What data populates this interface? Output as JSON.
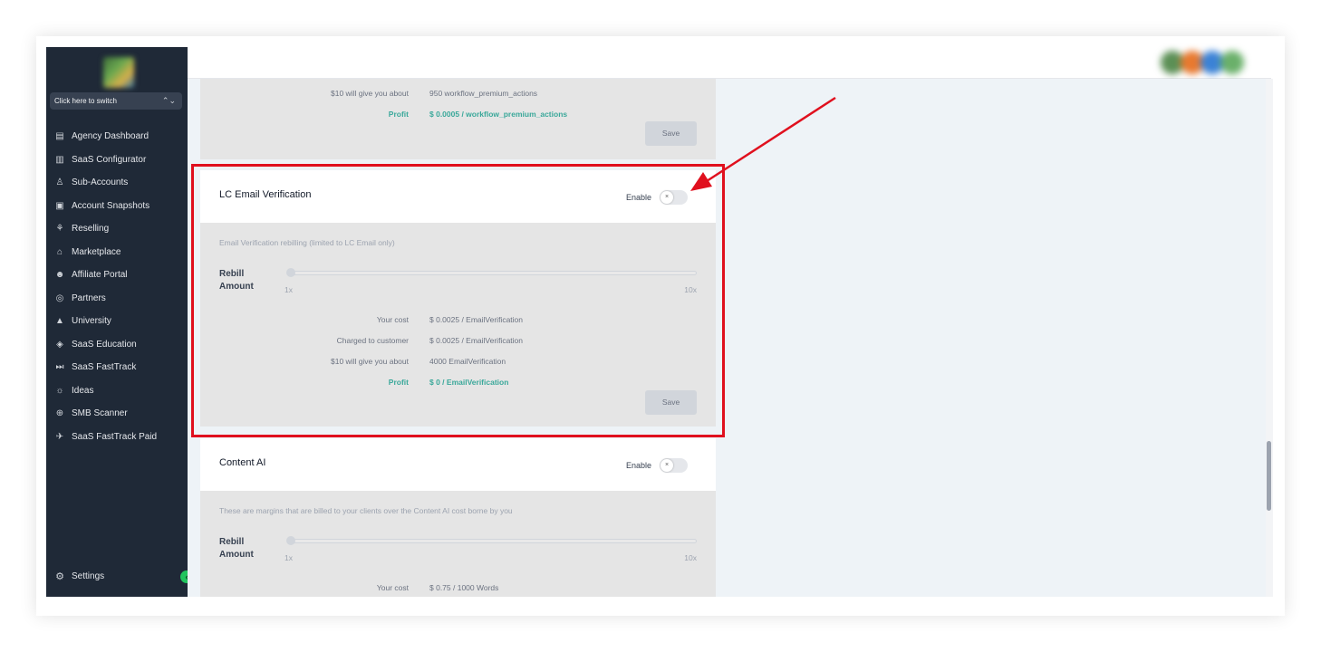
{
  "sidebar": {
    "switcher_label": "Click here to switch",
    "items": [
      {
        "label": "Agency Dashboard",
        "icon": "dashboard-icon"
      },
      {
        "label": "SaaS Configurator",
        "icon": "chart-icon"
      },
      {
        "label": "Sub-Accounts",
        "icon": "user-icon"
      },
      {
        "label": "Account Snapshots",
        "icon": "snapshot-icon"
      },
      {
        "label": "Reselling",
        "icon": "network-icon"
      },
      {
        "label": "Marketplace",
        "icon": "bag-icon"
      },
      {
        "label": "Affiliate Portal",
        "icon": "users-icon"
      },
      {
        "label": "Partners",
        "icon": "handshake-icon"
      },
      {
        "label": "University",
        "icon": "graduation-cap-icon"
      },
      {
        "label": "SaaS Education",
        "icon": "cube-icon"
      },
      {
        "label": "SaaS FastTrack",
        "icon": "fast-forward-icon"
      },
      {
        "label": "Ideas",
        "icon": "lightbulb-icon"
      },
      {
        "label": "SMB Scanner",
        "icon": "search-icon"
      },
      {
        "label": "SaaS FastTrack Paid",
        "icon": "plane-icon"
      }
    ],
    "settings_label": "Settings"
  },
  "top_card": {
    "rows": [
      {
        "label": "$10 will give you about",
        "value": "950 workflow_premium_actions"
      },
      {
        "label": "Profit",
        "value": "$ 0.0005 / workflow_premium_actions"
      }
    ],
    "save_label": "Save"
  },
  "email_card": {
    "title": "LC Email Verification",
    "enable_label": "Enable",
    "toggle_glyph": "×",
    "description": "Email Verification rebilling (limited to LC Email only)",
    "rebill_label_line1": "Rebill",
    "rebill_label_line2": "Amount",
    "slider_min": "1x",
    "slider_max": "10x",
    "rows": [
      {
        "label": "Your cost",
        "value": "$  0.0025 / EmailVerification"
      },
      {
        "label": "Charged to customer",
        "value": "$ 0.0025 / EmailVerification"
      },
      {
        "label": "$10 will give you about",
        "value": "4000 EmailVerification"
      },
      {
        "label": "Profit",
        "value": "$ 0 / EmailVerification"
      }
    ],
    "save_label": "Save"
  },
  "content_ai_card": {
    "title": "Content AI",
    "enable_label": "Enable",
    "toggle_glyph": "×",
    "description": "These are margins that are billed to your clients over the Content AI cost borne by you",
    "rebill_label_line1": "Rebill",
    "rebill_label_line2": "Amount",
    "slider_min": "1x",
    "slider_max": "10x",
    "rows": [
      {
        "label": "Your cost",
        "value": "$  0.75 / 1000 Words"
      }
    ]
  },
  "colors": {
    "sidebar_bg": "#1f2937",
    "accent_profit": "#3aa89a",
    "highlight_red": "#e0101e",
    "content_bg": "#eef3f7"
  }
}
